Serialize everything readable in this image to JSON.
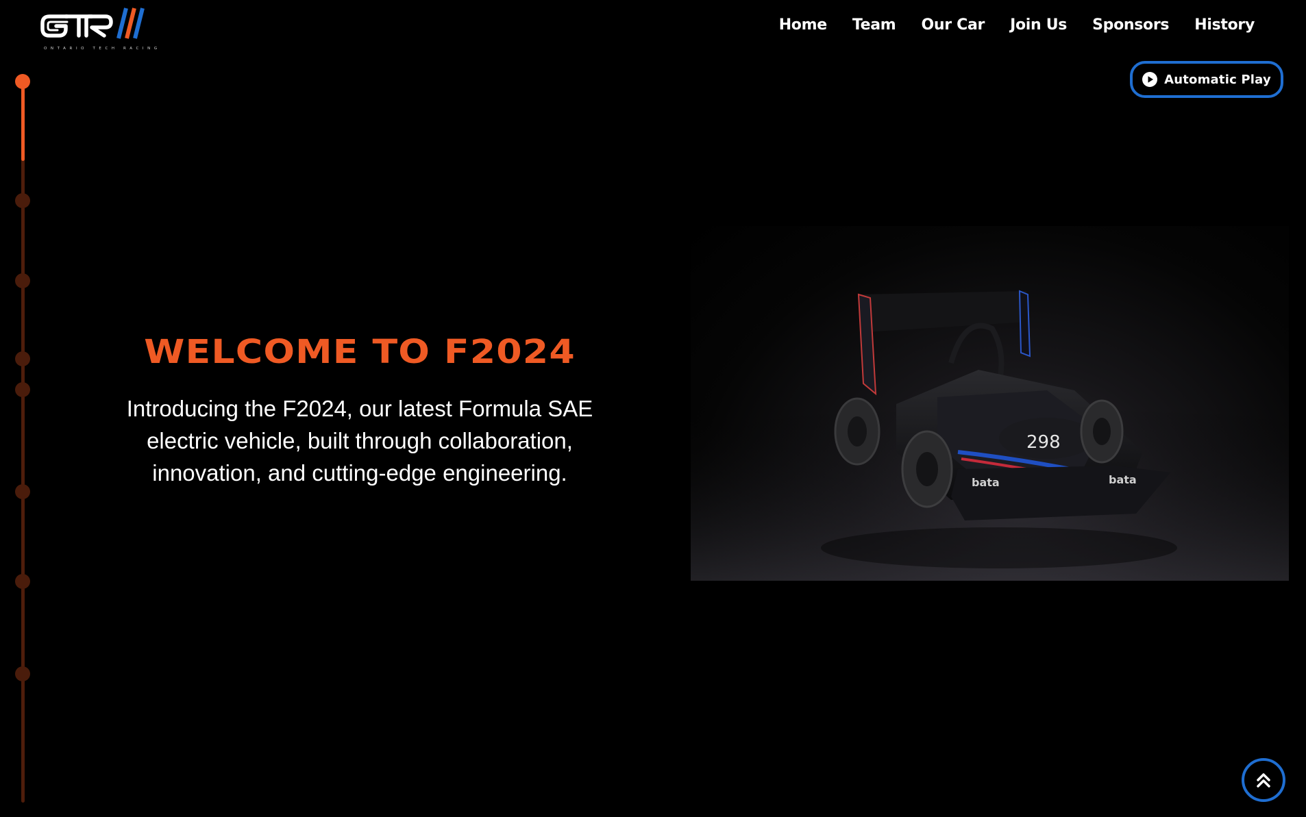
{
  "brand": {
    "logo_subtext": "ONTARIO TECH RACING",
    "colors": {
      "accent": "#ef5a24",
      "button_border": "#1f6ed1",
      "background": "#000000",
      "text": "#ffffff",
      "logo_stripe_blue": "#1f6ed1",
      "logo_stripe_orange": "#ef5a24"
    }
  },
  "nav": {
    "items": [
      {
        "label": "Home"
      },
      {
        "label": "Team"
      },
      {
        "label": "Our Car"
      },
      {
        "label": "Join Us"
      },
      {
        "label": "Sponsors"
      },
      {
        "label": "History"
      }
    ]
  },
  "auto_play": {
    "label": "Automatic Play",
    "icon": "play-circle-icon"
  },
  "timeline": {
    "total_steps": 8,
    "active_index": 0
  },
  "hero": {
    "title": "WELCOME TO F2024",
    "description": "Introducing the F2024, our latest Formula SAE electric vehicle, built through collaboration, innovation, and cutting-edge engineering."
  },
  "car_image": {
    "car_number": "298",
    "sponsor_text": "bata"
  },
  "scroll_top": {
    "icon": "double-chevron-up-icon"
  }
}
